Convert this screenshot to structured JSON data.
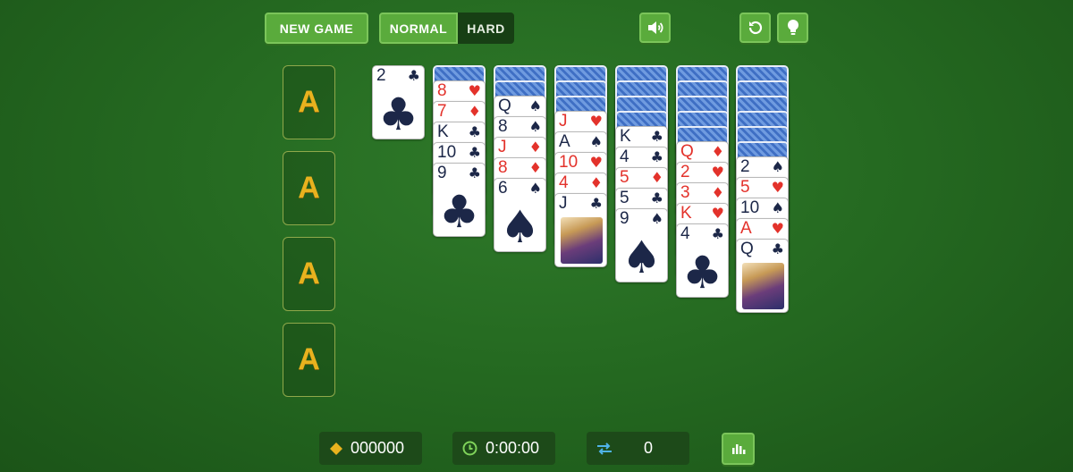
{
  "toolbar": {
    "new_game_label": "NEW GAME",
    "modes": [
      {
        "label": "NORMAL",
        "active": true
      },
      {
        "label": "HARD",
        "active": false
      }
    ]
  },
  "foundations": [
    {
      "label": "A"
    },
    {
      "label": "A"
    },
    {
      "label": "A"
    },
    {
      "label": "A"
    }
  ],
  "waste": [
    {
      "rank": "2",
      "suit": "♣",
      "color": "black"
    }
  ],
  "tableau": [
    {
      "hidden": 1,
      "cards": [
        {
          "rank": "8",
          "suit": "♥",
          "color": "red"
        },
        {
          "rank": "7",
          "suit": "♦",
          "color": "red"
        },
        {
          "rank": "K",
          "suit": "♣",
          "color": "black"
        },
        {
          "rank": "10",
          "suit": "♣",
          "color": "black"
        },
        {
          "rank": "9",
          "suit": "♣",
          "color": "black"
        }
      ]
    },
    {
      "hidden": 2,
      "cards": [
        {
          "rank": "Q",
          "suit": "♠",
          "color": "black"
        },
        {
          "rank": "8",
          "suit": "♠",
          "color": "black"
        },
        {
          "rank": "J",
          "suit": "♦",
          "color": "red"
        },
        {
          "rank": "8",
          "suit": "♦",
          "color": "red"
        },
        {
          "rank": "6",
          "suit": "♠",
          "color": "black"
        }
      ]
    },
    {
      "hidden": 3,
      "cards": [
        {
          "rank": "J",
          "suit": "♥",
          "color": "red"
        },
        {
          "rank": "A",
          "suit": "♠",
          "color": "black"
        },
        {
          "rank": "10",
          "suit": "♥",
          "color": "red"
        },
        {
          "rank": "4",
          "suit": "♦",
          "color": "red"
        },
        {
          "rank": "J",
          "suit": "♣",
          "color": "black",
          "face": true
        }
      ]
    },
    {
      "hidden": 4,
      "cards": [
        {
          "rank": "K",
          "suit": "♣",
          "color": "black"
        },
        {
          "rank": "4",
          "suit": "♣",
          "color": "black"
        },
        {
          "rank": "5",
          "suit": "♦",
          "color": "red"
        },
        {
          "rank": "5",
          "suit": "♣",
          "color": "black"
        },
        {
          "rank": "9",
          "suit": "♠",
          "color": "black"
        }
      ]
    },
    {
      "hidden": 5,
      "cards": [
        {
          "rank": "Q",
          "suit": "♦",
          "color": "red"
        },
        {
          "rank": "2",
          "suit": "♥",
          "color": "red"
        },
        {
          "rank": "3",
          "suit": "♦",
          "color": "red"
        },
        {
          "rank": "K",
          "suit": "♥",
          "color": "red"
        },
        {
          "rank": "4",
          "suit": "♣",
          "color": "black"
        }
      ]
    },
    {
      "hidden": 6,
      "cards": [
        {
          "rank": "2",
          "suit": "♠",
          "color": "black"
        },
        {
          "rank": "5",
          "suit": "♥",
          "color": "red"
        },
        {
          "rank": "10",
          "suit": "♠",
          "color": "black"
        },
        {
          "rank": "A",
          "suit": "♥",
          "color": "red"
        },
        {
          "rank": "Q",
          "suit": "♣",
          "color": "black",
          "face": true
        }
      ]
    }
  ],
  "stats": {
    "score": "000000",
    "time": "0:00:00",
    "moves": "0"
  },
  "colors": {
    "felt": "#256a21",
    "button": "#5aab3c",
    "foundation_letter": "#e8b21e",
    "red_suit": "#e3322b",
    "black_suit": "#1c2748"
  },
  "icons": [
    "volume-icon",
    "undo-icon",
    "hint-bulb-icon",
    "coin-icon",
    "clock-icon",
    "moves-arrows-icon",
    "stats-icon"
  ]
}
